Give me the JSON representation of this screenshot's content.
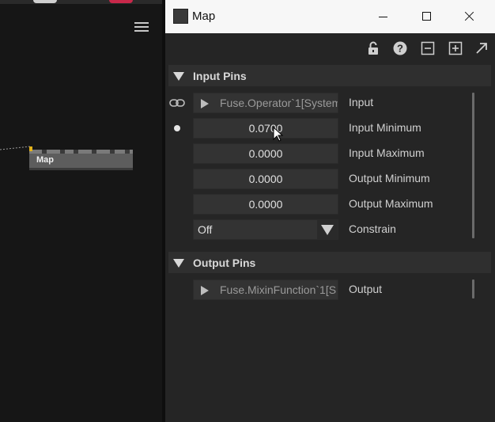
{
  "graph": {
    "node": {
      "title": "Map"
    }
  },
  "window": {
    "title": "Map"
  },
  "toolbar": {
    "icons": [
      "unlock-icon",
      "help-icon",
      "collapse-icon",
      "expand-icon",
      "open-external-icon"
    ]
  },
  "input_pins": {
    "title": "Input Pins",
    "rows": [
      {
        "kind": "link",
        "value": "Fuse.Operator`1[System",
        "label": "Input"
      },
      {
        "kind": "number",
        "value": "0.0700",
        "label": "Input Minimum"
      },
      {
        "kind": "number",
        "value": "0.0000",
        "label": "Input Maximum"
      },
      {
        "kind": "number",
        "value": "0.0000",
        "label": "Output Minimum"
      },
      {
        "kind": "number",
        "value": "0.0000",
        "label": "Output Maximum"
      },
      {
        "kind": "select",
        "value": "Off",
        "label": "Constrain"
      }
    ]
  },
  "output_pins": {
    "title": "Output Pins",
    "rows": [
      {
        "kind": "link",
        "value": "Fuse.MixinFunction`1[S",
        "label": "Output"
      }
    ]
  },
  "colors": {
    "panel_bg": "#252525",
    "section_bg": "#2f2f2f",
    "field_bg": "#333333",
    "node_bg": "#5d5d5d",
    "port_accent": "#e2b21a"
  }
}
